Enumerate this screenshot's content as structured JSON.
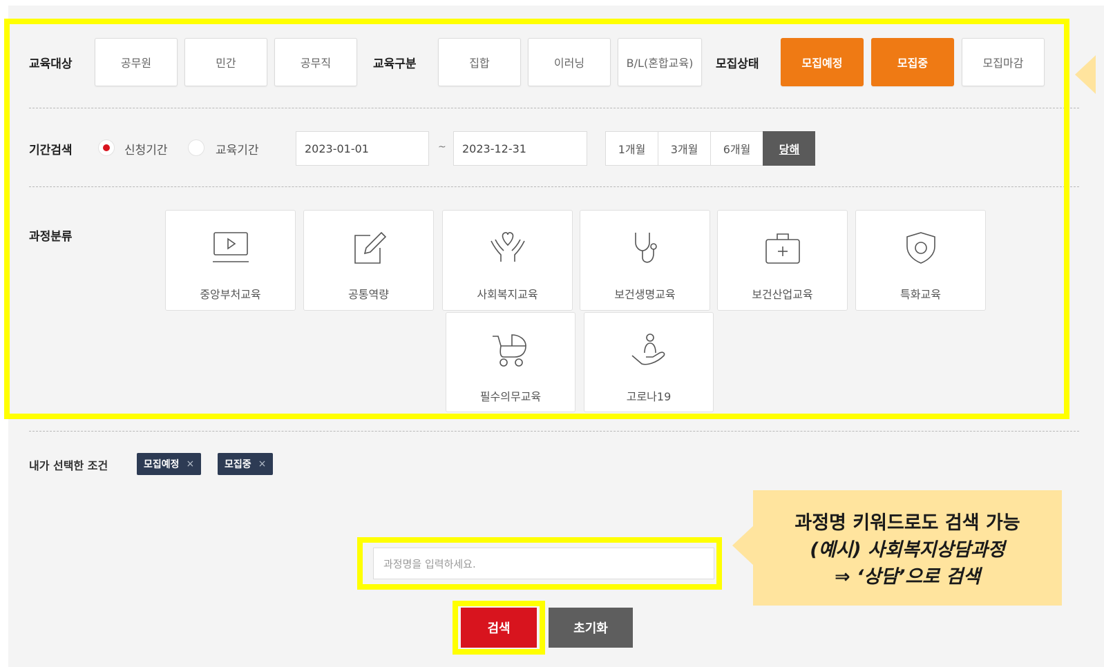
{
  "filters": {
    "target_label": "교육대상",
    "target_options": [
      "공무원",
      "민간",
      "공무직"
    ],
    "type_label": "교육구분",
    "type_options": [
      "집합",
      "이러닝",
      "B/L(혼합교육)"
    ],
    "status_label": "모집상태",
    "status_options": [
      "모집예정",
      "모집중",
      "모집마감"
    ]
  },
  "period": {
    "label": "기간검색",
    "radio_apply": "신청기간",
    "radio_edu": "교육기간",
    "start_date": "2023-01-01",
    "tilde": "~",
    "end_date": "2023-12-31",
    "buttons": [
      "1개월",
      "3개월",
      "6개월",
      "당해"
    ]
  },
  "category": {
    "label": "과정분류",
    "items": [
      {
        "label": "중앙부처교육",
        "icon": "play-video-icon"
      },
      {
        "label": "공통역량",
        "icon": "edit-icon"
      },
      {
        "label": "사회복지교육",
        "icon": "heart-hands-icon"
      },
      {
        "label": "보건생명교육",
        "icon": "stethoscope-icon"
      },
      {
        "label": "보건산업교육",
        "icon": "first-aid-kit-icon"
      },
      {
        "label": "특화교육",
        "icon": "shield-icon"
      },
      {
        "label": "필수의무교육",
        "icon": "stroller-icon"
      },
      {
        "label": "고로나19",
        "icon": "care-hand-icon"
      }
    ]
  },
  "selected": {
    "label": "내가 선택한 조건",
    "tags": [
      "모집예정",
      "모집중"
    ],
    "remove_symbol": "×"
  },
  "search": {
    "placeholder": "과정명을 입력하세요.",
    "search_button": "검색",
    "reset_button": "초기화"
  },
  "note": {
    "line1": "과정명 키워드로도 검색 가능",
    "line2": "(예시) 사회복지상담과정",
    "line3": "⇒ ‘상담’으로 검색"
  },
  "colors": {
    "accent_orange": "#ef7a14",
    "highlight_yellow": "#ffff00",
    "search_red": "#d8141e",
    "reset_gray": "#5e5e5e",
    "tag_navy": "#2d3b54",
    "note_bg": "#ffe49e"
  }
}
